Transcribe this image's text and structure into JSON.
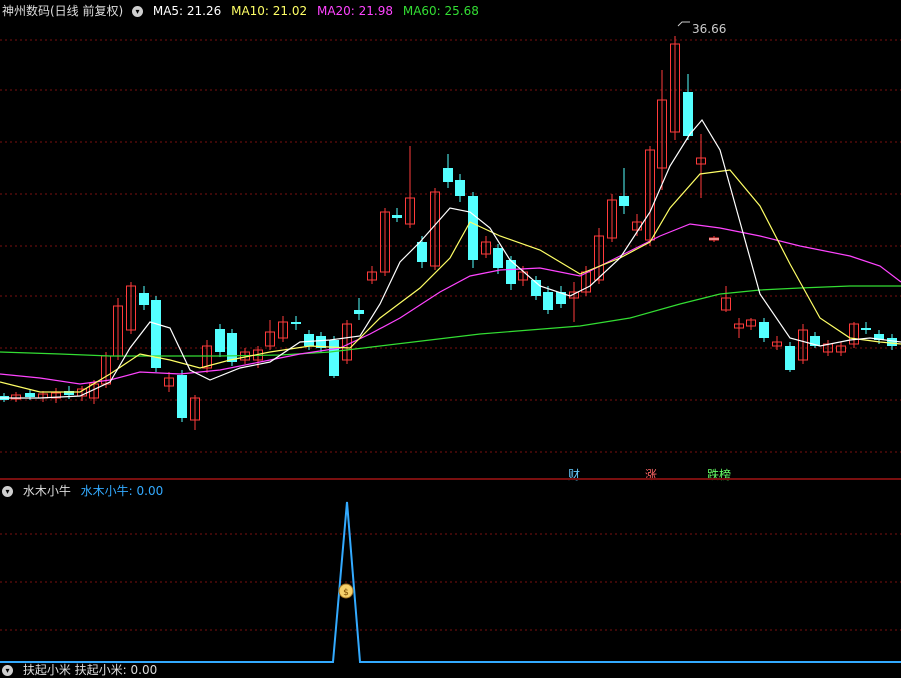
{
  "main": {
    "title": "神州数码(日线 前复权)",
    "ma": [
      {
        "label": "MA5: 21.26",
        "color": "#ffffff"
      },
      {
        "label": "MA10: 21.02",
        "color": "#ffff66"
      },
      {
        "label": "MA20: 21.98",
        "color": "#ff44ff"
      },
      {
        "label": "MA60: 25.68",
        "color": "#33dd33"
      }
    ],
    "peak_label": "36.66",
    "events": [
      {
        "label": "财",
        "color": "#66ccff"
      },
      {
        "label": "涨",
        "color": "#ff6666"
      },
      {
        "label": "跌榜",
        "color": "#66ff66"
      }
    ]
  },
  "sub": {
    "title": "水木小牛",
    "value_label": "水木小牛: 0.00",
    "bottom_label": "扶起小米 扶起小米: 0.00",
    "signal_icon": "money-bag-icon"
  },
  "colors": {
    "up": "#ff3b3b",
    "down": "#54ffff",
    "grid": "#7a1010",
    "signal": "#33aaff"
  }
}
